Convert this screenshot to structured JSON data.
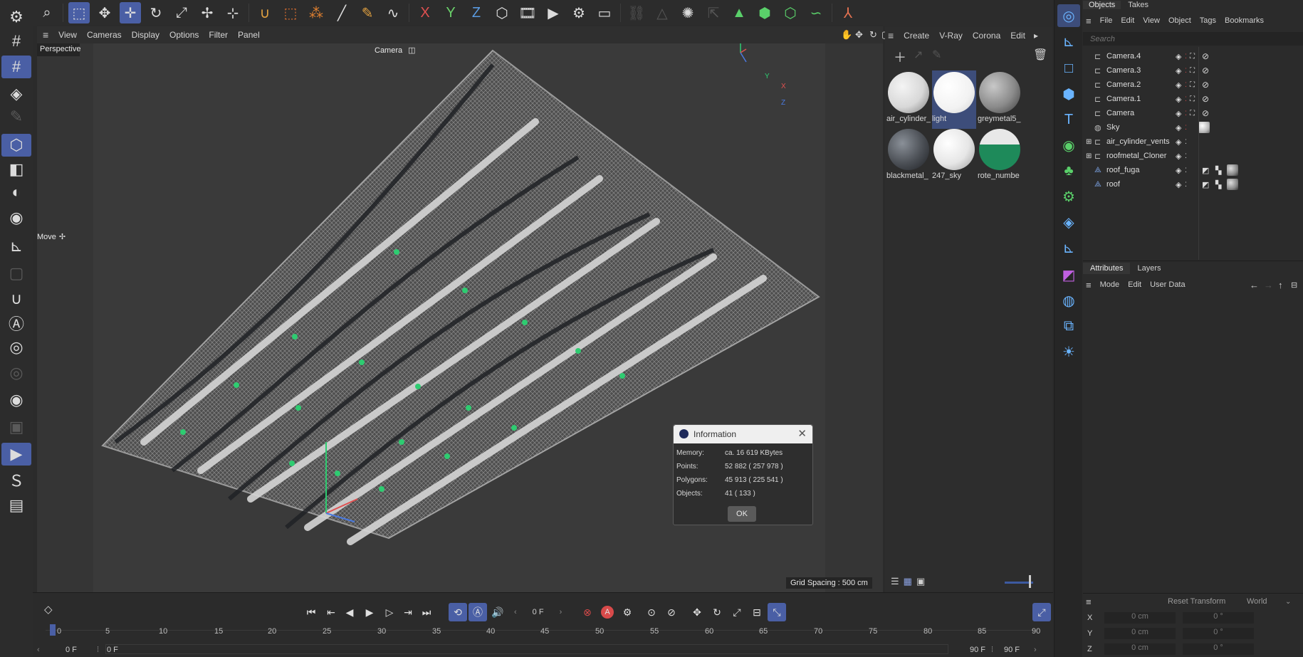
{
  "viewport": {
    "menu": [
      "View",
      "Cameras",
      "Display",
      "Options",
      "Filter",
      "Panel"
    ],
    "view_name": "Perspective",
    "camera_label": "Camera",
    "tool_label": "Move",
    "grid_spacing": "Grid Spacing : 500 cm",
    "axis": {
      "x": "X",
      "y": "Y",
      "z": "Z"
    }
  },
  "materials": {
    "menu": [
      "Create",
      "V-Ray",
      "Corona",
      "Edit"
    ],
    "items": [
      {
        "label": "air_cylinder_",
        "color": "#d8d8d8"
      },
      {
        "label": "light",
        "color": "#ffffff"
      },
      {
        "label": "greymetal5_",
        "color": "#8a8a8a"
      },
      {
        "label": "blackmetal_",
        "color": "#4a4e54"
      },
      {
        "label": "247_sky",
        "color": "#e6e6e6"
      },
      {
        "label": "rote_numbe",
        "color": "#1e8a5a"
      }
    ]
  },
  "objects": {
    "tabs": [
      "Objects",
      "Takes"
    ],
    "menu": [
      "File",
      "Edit",
      "View",
      "Object",
      "Tags",
      "Bookmarks"
    ],
    "search_placeholder": "Search",
    "rows": [
      {
        "name": "Camera.4",
        "icon": "camera-icon"
      },
      {
        "name": "Camera.3",
        "icon": "camera-icon"
      },
      {
        "name": "Camera.2",
        "icon": "camera-icon"
      },
      {
        "name": "Camera.1",
        "icon": "camera-icon"
      },
      {
        "name": "Camera",
        "icon": "camera-icon"
      },
      {
        "name": "Sky",
        "icon": "sky-icon"
      },
      {
        "name": "air_cylinder_vents",
        "icon": "null-icon"
      },
      {
        "name": "roofmetal_Cloner",
        "icon": "cloner-icon"
      },
      {
        "name": "roof_fuga",
        "icon": "polygon-icon"
      },
      {
        "name": "roof",
        "icon": "polygon-icon"
      }
    ]
  },
  "attributes": {
    "tabs": [
      "Attributes",
      "Layers"
    ],
    "menu": [
      "Mode",
      "Edit",
      "User Data"
    ]
  },
  "coords": {
    "reset": "Reset Transform",
    "world": "World",
    "rows": [
      {
        "axis": "X",
        "pos": "0 cm",
        "rot": "0 °"
      },
      {
        "axis": "Y",
        "pos": "0 cm",
        "rot": "0 °"
      },
      {
        "axis": "Z",
        "pos": "0 cm",
        "rot": "0 °"
      }
    ]
  },
  "timeline": {
    "frame": "0 F",
    "ticks": [
      "0",
      "5",
      "10",
      "15",
      "20",
      "25",
      "30",
      "35",
      "40",
      "45",
      "50",
      "55",
      "60",
      "65",
      "70",
      "75",
      "80",
      "85",
      "90"
    ],
    "start": "0 F",
    "start2": "0 F",
    "end": "90 F",
    "end2": "90 F"
  },
  "info_dialog": {
    "title": "Information",
    "rows": [
      {
        "label": "Memory:",
        "value": "ca. 16 619 KBytes"
      },
      {
        "label": "Points:",
        "value": "52 882 ( 257 978 )"
      },
      {
        "label": "Polygons:",
        "value": "45 913 ( 225 541 )"
      },
      {
        "label": "Objects:",
        "value": "41 ( 133 )"
      }
    ],
    "ok": "OK"
  }
}
